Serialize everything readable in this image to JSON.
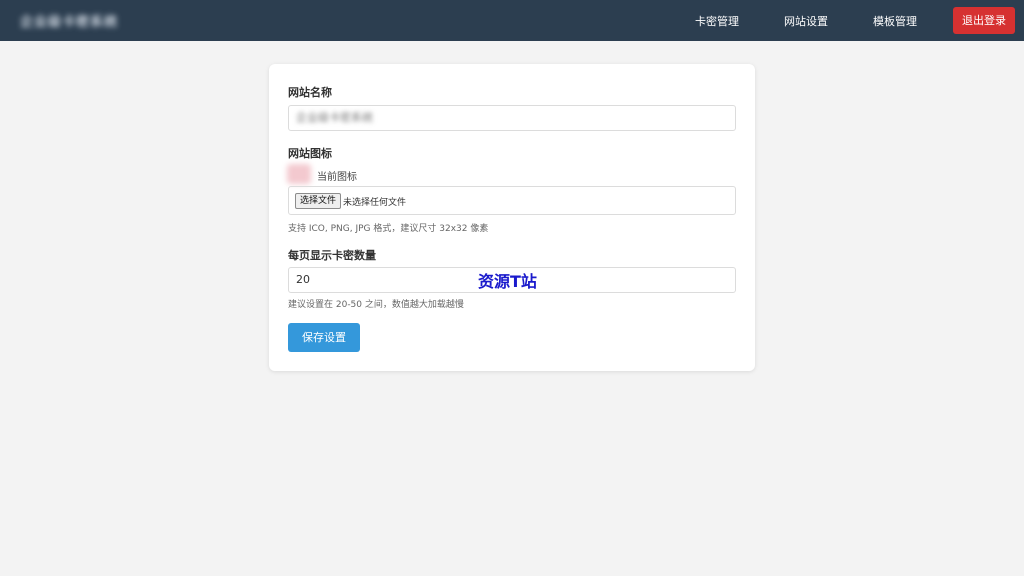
{
  "header": {
    "brand": "企业级卡密系统",
    "nav": [
      "卡密管理",
      "网站设置",
      "模板管理"
    ],
    "logout_label": "退出登录"
  },
  "form": {
    "site_name_label": "网站名称",
    "site_name_value": "企业级卡密系统",
    "site_icon_label": "网站图标",
    "current_icon_label": "当前图标",
    "choose_file_label": "选择文件",
    "no_file_text": "未选择任何文件",
    "icon_hint": "支持 ICO, PNG, JPG 格式，建议尺寸 32x32 像素",
    "per_page_label": "每页显示卡密数量",
    "per_page_value": "20",
    "per_page_hint": "建议设置在 20-50 之间，数值越大加载越慢",
    "save_label": "保存设置"
  },
  "watermark": "资源T站",
  "colors": {
    "header_bg": "#2c3e50",
    "logout_bg": "#d63131",
    "save_bg": "#3498db"
  }
}
